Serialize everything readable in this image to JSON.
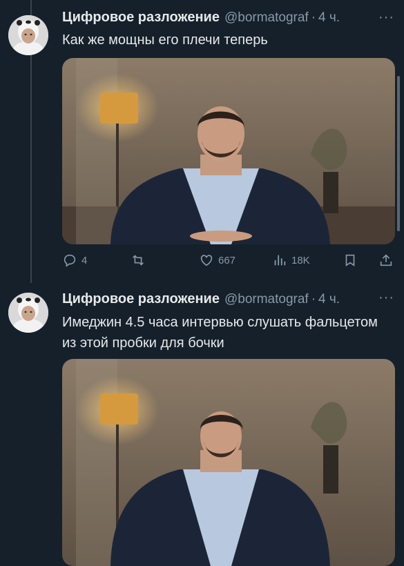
{
  "tweets": [
    {
      "author": "Цифровое разложение",
      "handle": "@bormatograf",
      "separator": "·",
      "time": "4 ч.",
      "more": "···",
      "text": "Как же мощны его плечи теперь",
      "actions": {
        "replies": "4",
        "retweets": "",
        "likes": "667",
        "views": "18K"
      }
    },
    {
      "author": "Цифровое разложение",
      "handle": "@bormatograf",
      "separator": "·",
      "time": "4 ч.",
      "more": "···",
      "text": "Имеджин 4.5 часа интервью слушать фальцетом из этой пробки для бочки"
    }
  ],
  "colors": {
    "background": "#15202b",
    "text": "#e7e9ea",
    "secondary": "#8b98a5",
    "thread_line": "#38444d"
  },
  "icons": [
    "reply-icon",
    "retweet-icon",
    "like-icon",
    "views-icon",
    "bookmark-icon",
    "share-icon",
    "more-icon"
  ]
}
